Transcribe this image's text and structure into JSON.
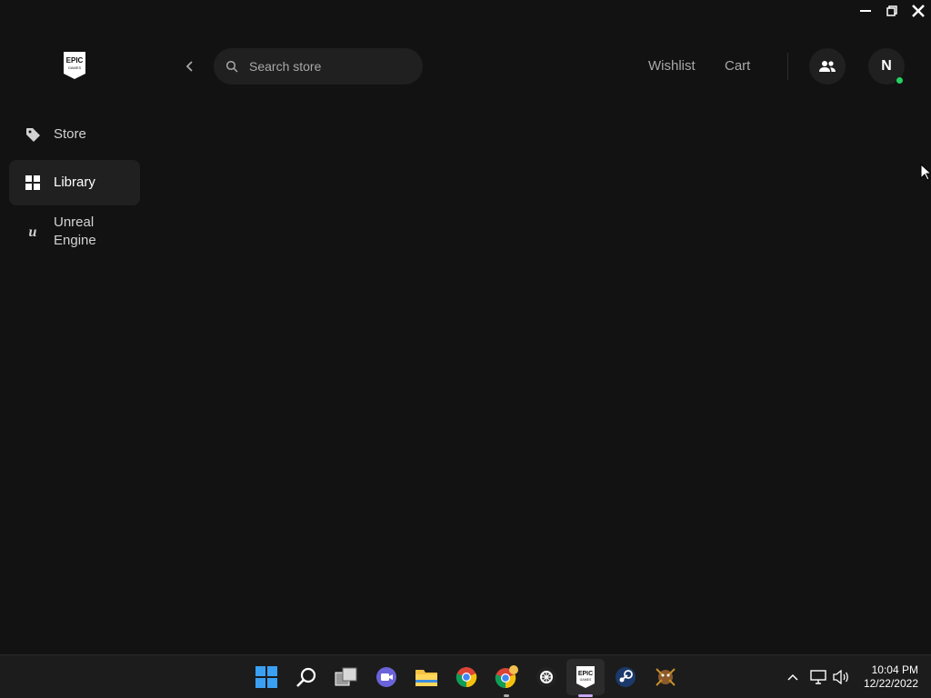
{
  "window": {
    "controls": [
      "minimize",
      "restore",
      "close"
    ]
  },
  "sidebar": {
    "logo_text": "EPIC GAMES",
    "items": [
      {
        "label": "Store",
        "icon": "tag-icon",
        "active": false
      },
      {
        "label": "Library",
        "icon": "grid-icon",
        "active": true
      },
      {
        "label": "Unreal Engine",
        "icon": "unreal-icon",
        "active": false
      }
    ]
  },
  "header": {
    "search_placeholder": "Search store",
    "wishlist_label": "Wishlist",
    "cart_label": "Cart",
    "friends_icon": "friends-icon",
    "avatar_letter": "N",
    "online_color": "#23d160"
  },
  "taskbar": {
    "apps": [
      "windows-start",
      "search",
      "task-view",
      "teams-chat",
      "file-explorer",
      "chrome",
      "chrome-canary",
      "app",
      "epic-games",
      "steam",
      "game"
    ],
    "active_app": "epic-games",
    "clock_time": "10:04 PM",
    "clock_date": "12/22/2022"
  },
  "colors": {
    "background": "#121212",
    "surface": "#202020",
    "taskbar": "#1c1c1c"
  }
}
